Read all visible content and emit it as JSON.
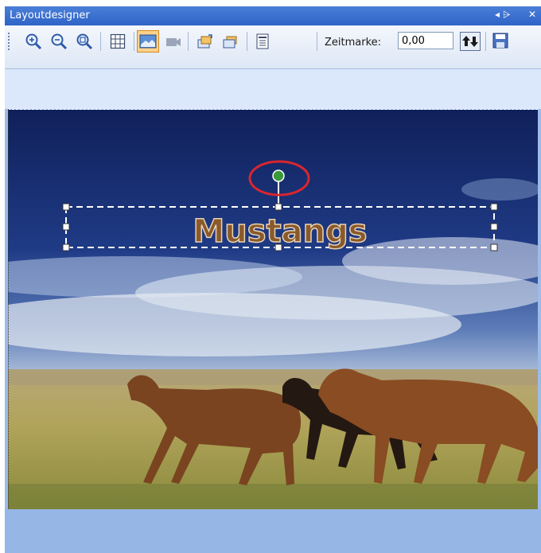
{
  "window": {
    "title": "Layoutdesigner",
    "pin_glyph": "◂ ⩥",
    "close_glyph": "✕"
  },
  "toolbar": {
    "buttons": [
      {
        "name": "zoom-in-icon"
      },
      {
        "name": "zoom-out-icon"
      },
      {
        "name": "zoom-fit-icon"
      },
      {
        "name": "grid-icon"
      },
      {
        "name": "layout-view-icon",
        "active": true
      },
      {
        "name": "camera-icon"
      },
      {
        "name": "bring-forward-icon"
      },
      {
        "name": "send-backward-icon"
      },
      {
        "name": "properties-icon"
      }
    ],
    "zeitmarke_label": "Zeitmarke:",
    "zeitmarke_value": "0,00"
  },
  "canvas": {
    "text_object": "Mustangs",
    "text_color": "#8a5a2a",
    "accent_red": "#d8262e",
    "rotate_handle_color": "#3a9a3a"
  }
}
